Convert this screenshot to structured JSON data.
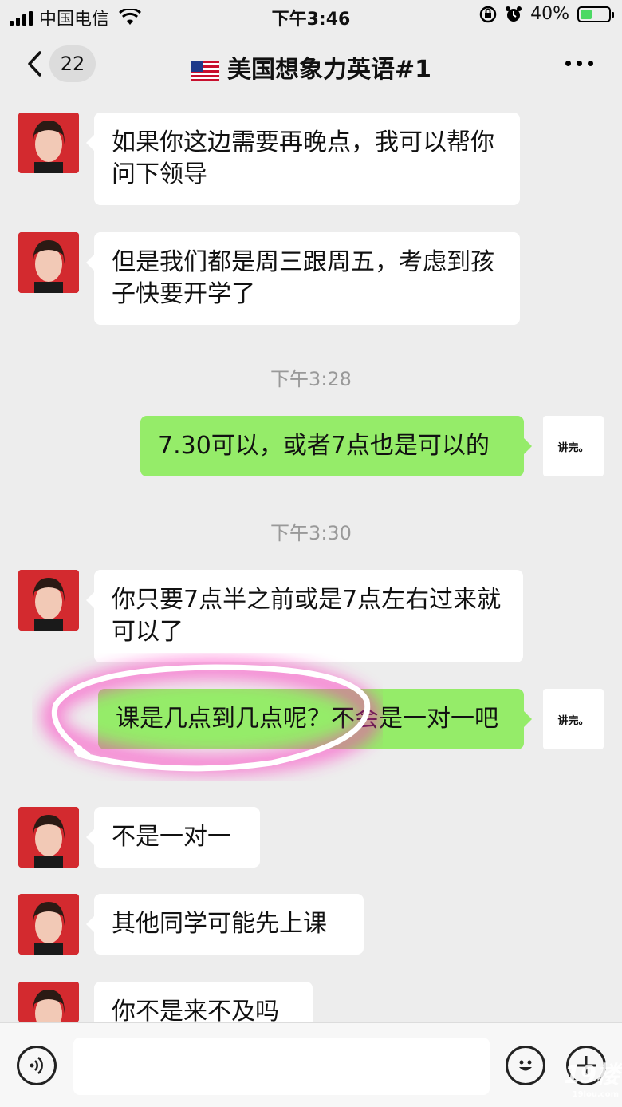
{
  "status_bar": {
    "carrier": "中国电信",
    "time": "下午3:46",
    "battery": "40%",
    "battery_level": 0.4
  },
  "nav": {
    "unread_count": "22",
    "title": "美国想象力英语#1"
  },
  "messages": [
    {
      "text": "如果你这边需要再晚点，我可以帮你问下领导"
    },
    {
      "text": "但是我们都是周三跟周五，考虑到孩子快要开学了"
    },
    {
      "timestamp": "下午3:28"
    },
    {
      "text": "7.30可以，或者7点也是可以的",
      "self_avatar": "讲完。"
    },
    {
      "timestamp": "下午3:30"
    },
    {
      "text": "你只要7点半之前或是7点左右过来就可以了"
    },
    {
      "text": "课是几点到几点呢？不会是一对一吧",
      "self_avatar": "讲完。"
    },
    {
      "text": "不是一对一"
    },
    {
      "text": "其他同学可能先上课"
    },
    {
      "text": "你不是来不及吗"
    }
  ],
  "input": {
    "placeholder": ""
  },
  "watermark": {
    "main": "19楼",
    "sub": "19lou.com"
  },
  "colors": {
    "self_bubble": "#95ec69",
    "other_bubble": "#ffffff",
    "background": "#ededed",
    "highlight": "#ff2dbe"
  },
  "icons": [
    "back-chevron-icon",
    "us-flag-icon",
    "more-icon",
    "voice-icon",
    "emoji-icon",
    "plus-icon"
  ]
}
